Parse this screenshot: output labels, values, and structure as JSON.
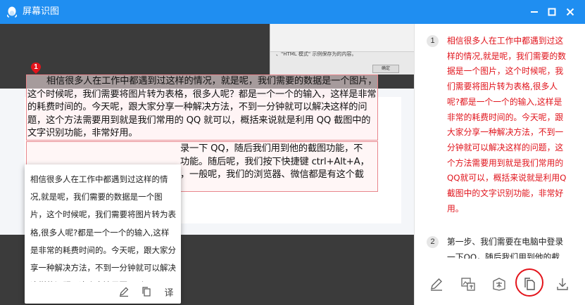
{
  "window": {
    "title": "屏幕识图"
  },
  "background": {
    "dialog_text": "、\"HTML 模式\" 示例保存为的内容。",
    "dialog_ok": "确定"
  },
  "document": {
    "marker": "1",
    "paragraph1": "相信很多人在工作中都遇到过这样的情况，就是呢，我们需要的数据是一个图片，这个时候呢，我们需要将图片转为表格，很多人呢？都是一个一个的输入，这样是非常的耗费时间的。今天呢，跟大家分享一种解决方法，不到一分钟就可以解决这样的问题，这个方法需要用到就是我们常用的 QQ 就可以，概括来说就是利用 QQ 截图中的文字识别功能，非常好用。",
    "paragraph2_lines": [
      "录一下 QQ，随后我们用到他的截图功能，不",
      "功能。随后呢，我们按下快捷键 ctrl+Alt+A，",
      "，一般呢，我们的浏览器、微信都是有这个截"
    ]
  },
  "popup": {
    "text": "相信很多人在工作中都遇到过这样的情况,就是呢，我们需要的数据是一个图片，这个时候呢，我们需要将图片转为表格,很多人呢?都是一个一个的输入,这样是非常的耗费时间的。今天呢，跟大家分享一种解决方法，不到一分钟就可以解决这样的问题，这个方法需要用到",
    "tools": {
      "edit_icon": "edit-icon",
      "copy_icon": "copy-icon",
      "translate_label": "译"
    }
  },
  "results": {
    "items": [
      {
        "number": "1",
        "text": "相信很多人在工作中都遇到过这样的情况,就是呢，我们需要的数据是一个图片，这个时候呢，我们需要将图片转为表格,很多人呢?都是一个一个的输入,这样是非常的耗费时间的。今天呢，跟大家分享一种解决方法，不到一分钟就可以解决这样的问题，这个方法需要用到就是我们常用的QQ就可以，概括来说就是利用Q截图中的文字识别功能，非常好用。"
      },
      {
        "number": "2",
        "text": "第一步、我们需要在电脑中登录一下QQ，随后我们用到他的截"
      }
    ],
    "toolbar": [
      "edit-icon",
      "image-text-icon",
      "translate-icon",
      "copy-icon",
      "download-icon"
    ]
  },
  "colors": {
    "titlebar": "#1f8ef1",
    "highlight_red": "#e0131b"
  }
}
